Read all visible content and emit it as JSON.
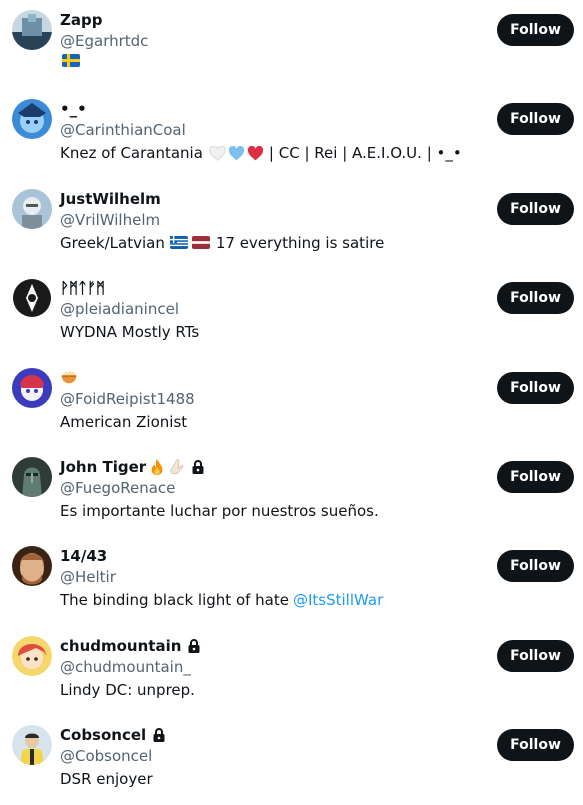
{
  "follow_label": "Follow",
  "users": [
    {
      "name": "Zapp",
      "handle": "@Egarhrtdc",
      "bio": "",
      "bio_flag": "sweden-flag",
      "locked": false,
      "avatar_colors": [
        "#6e8fa8",
        "#2a4356",
        "#c8d6e0"
      ]
    },
    {
      "name": "•_•",
      "handle": "@CarinthianCoal",
      "bio": "Knez of Carantania",
      "bio_after": "| CC | Rei | A.E.I.O.U. | •_•",
      "locked": false,
      "avatar_colors": [
        "#3b8bd9",
        "#9ad0f5",
        "#1c3e6e"
      ]
    },
    {
      "name": "JustWilhelm",
      "handle": "@VrilWilhelm",
      "bio": "Greek/Latvian",
      "bio_after": "17 everything is satire",
      "locked": false,
      "avatar_colors": [
        "#a9c4d6",
        "#e6eef2",
        "#7e8e9c"
      ]
    },
    {
      "name": "ᚹᛗᛏᚠᛗ",
      "handle": "@pleiadianincel",
      "bio": "WYDNA Mostly RTs",
      "locked": false,
      "avatar_colors": [
        "#1a1a1a",
        "#ffffff",
        "#555555"
      ]
    },
    {
      "name": "🍜",
      "handle": "@FoidReipist1488",
      "bio": "American Zionist",
      "locked": false,
      "avatar_colors": [
        "#d8334a",
        "#3b3bbd",
        "#f3f3f3"
      ]
    },
    {
      "name": "John Tiger",
      "handle": "@FuegoRenace",
      "bio": "Es importante luchar por nuestros sueños.",
      "locked": true,
      "avatar_colors": [
        "#2e3b36",
        "#5f7b72",
        "#9aa89f"
      ]
    },
    {
      "name": "14/43",
      "handle": "@Heltir",
      "bio": "The binding black light of hate",
      "bio_link": "@ItsStillWar",
      "locked": false,
      "avatar_colors": [
        "#a0633a",
        "#e0b088",
        "#3a2214"
      ]
    },
    {
      "name": "chudmountain",
      "handle": "@chudmountain_",
      "bio": "Lindy DC: unprep.",
      "locked": true,
      "avatar_colors": [
        "#e04e3a",
        "#f5d76e",
        "#3a2a1f"
      ]
    },
    {
      "name": "Cobsoncel",
      "handle": "@Cobsoncel",
      "bio": "DSR enjoyer",
      "locked": true,
      "avatar_colors": [
        "#f2d54b",
        "#2a2a2a",
        "#d8e4ec"
      ]
    }
  ]
}
